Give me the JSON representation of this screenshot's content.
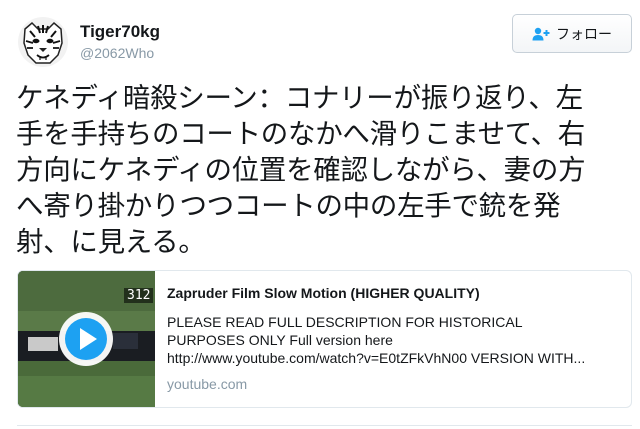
{
  "user": {
    "display_name": "Tiger70kg",
    "handle": "@2062Who",
    "avatar_icon": "tiger-avatar"
  },
  "follow_button": {
    "label": "フォロー",
    "icon": "person-plus-icon",
    "icon_color": "#1da1f2"
  },
  "tweet": {
    "text_lines": [
      "ケネディ暗殺シーン：コナリーが振り返り、左",
      "手を手持ちのコートのなかへ滑りこませて、右",
      "方向にケネディの位置を確認しながら、妻の方",
      "へ寄り掛かりつつコートの中の左手で銃を発",
      "射、に見える。"
    ]
  },
  "card": {
    "frame_number": "312",
    "title": "Zapruder Film Slow Motion (HIGHER QUALITY)",
    "description_lines": [
      "PLEASE READ FULL DESCRIPTION FOR HISTORICAL",
      "PURPOSES ONLY Full version here",
      "http://www.youtube.com/watch?v=E0tZFkVhN00 VERSION WITH..."
    ],
    "domain": "youtube.com",
    "play_icon": "play-icon",
    "play_color": "#1da1f2"
  }
}
